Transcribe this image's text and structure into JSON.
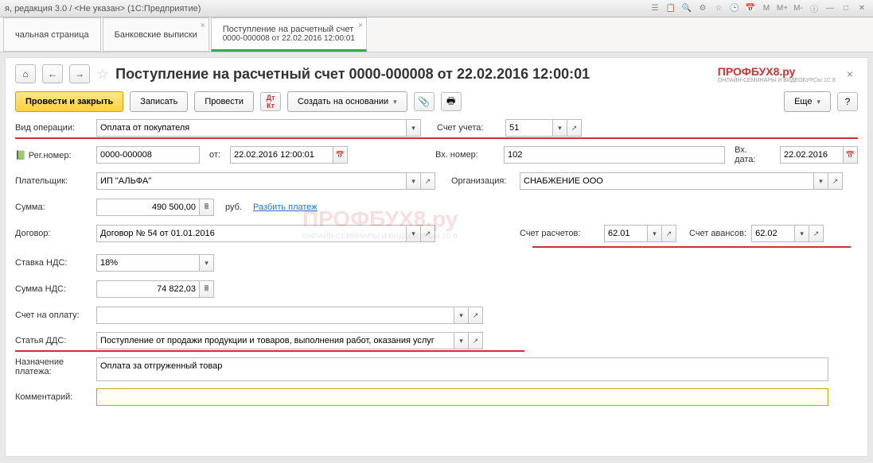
{
  "titlebar": "я, редакция 3.0 / <Не указан>  (1С:Предприятие)",
  "tabs": [
    {
      "label": "чальная страница"
    },
    {
      "label": "Банковские выписки"
    },
    {
      "label": "Поступление на расчетный счет",
      "sub": "0000-000008 от 22.02.2016 12:00:01",
      "active": true
    }
  ],
  "page_title": "Поступление на расчетный счет 0000-000008 от 22.02.2016 12:00:01",
  "brand": "ПРОФБУХ8.ру",
  "brand_sub": "ОНЛАЙН-СЕМИНАРЫ И ВИДЕОКУРСЫ 1С 8",
  "toolbar": {
    "post_close": "Провести и закрыть",
    "save": "Записать",
    "post": "Провести",
    "create_on": "Создать на основании",
    "more": "Еще"
  },
  "labels": {
    "op_type": "Вид операции:",
    "account": "Счет учета:",
    "reg_no": "Рег.номер:",
    "from": "от:",
    "in_no": "Вх. номер:",
    "in_date": "Вх. дата:",
    "payer": "Плательщик:",
    "org": "Организация:",
    "sum": "Сумма:",
    "rub": "руб.",
    "split": "Разбить платеж",
    "contract": "Договор:",
    "acc_calc": "Счет расчетов:",
    "acc_adv": "Счет авансов:",
    "vat_rate": "Ставка НДС:",
    "vat_sum": "Сумма НДС:",
    "invoice": "Счет на оплату:",
    "dds": "Статья ДДС:",
    "purpose": "Назначение платежа:",
    "comment": "Комментарий:"
  },
  "values": {
    "op_type": "Оплата от покупателя",
    "account": "51",
    "reg_no": "0000-000008",
    "date": "22.02.2016 12:00:01",
    "in_no": "102",
    "in_date": "22.02.2016",
    "payer": "ИП \"АЛЬФА\"",
    "org": "СНАБЖЕНИЕ ООО",
    "sum": "490 500,00",
    "contract": "Договор № 54 от 01.01.2016",
    "acc_calc": "62.01",
    "acc_adv": "62.02",
    "vat_rate": "18%",
    "vat_sum": "74 822,03",
    "invoice": "",
    "dds": "Поступление от продажи продукции и товаров, выполнения работ, оказания услуг",
    "purpose": "Оплата за отгруженный товар",
    "comment": ""
  }
}
